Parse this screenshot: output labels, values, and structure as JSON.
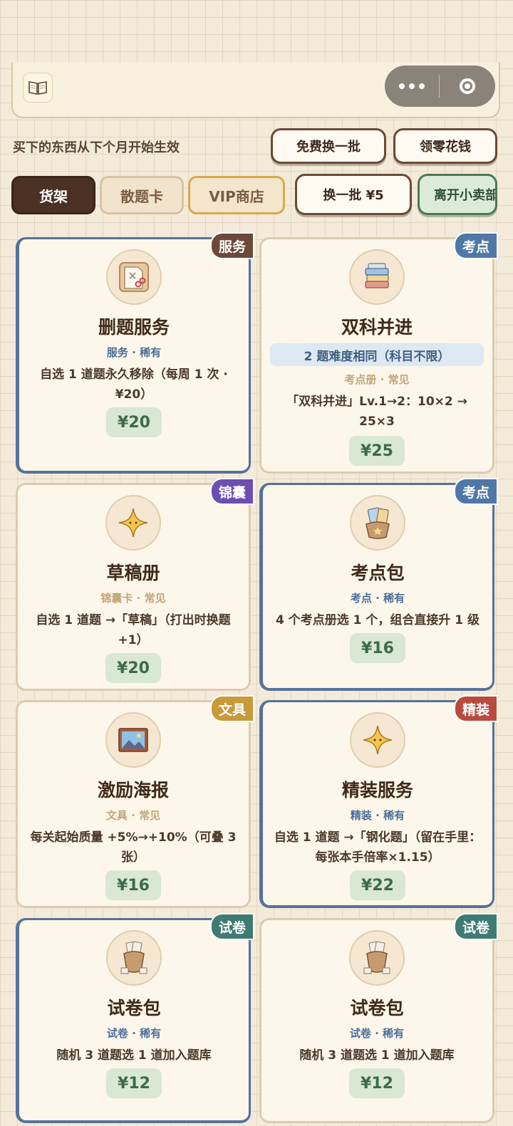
{
  "notice": "买下的东西从下个月开始生效",
  "buttons": {
    "free_refresh": "免费换一批",
    "collect_money": "领零花钱",
    "refresh_paid": "换一批 ¥5",
    "leave_shop": "离开小卖部"
  },
  "tabs": [
    "货架",
    "散题卡",
    "VIP商店"
  ],
  "cards": [
    {
      "badge": "服务",
      "badge_color": "#6b4a3a",
      "title": "删题服务",
      "type_label": "服务",
      "rarity": "稀有",
      "meta_color": "#4a6f99",
      "desc": "自选 1 道题永久移除（每周 1 次 · ¥20）",
      "price": "¥20",
      "icon": "scissors-paper-icon"
    },
    {
      "badge": "考点",
      "badge_color": "#4f78a6",
      "title": "双科并进",
      "highlight": "2 题难度相同（科目不限）",
      "type_label": "考点册",
      "rarity": "常见",
      "meta_color": "#c2a47a",
      "desc": "「双科并进」Lv.1→2：10×2 → 25×3",
      "price": "¥25",
      "icon": "book-stack-icon"
    },
    {
      "badge": "锦囊",
      "badge_color": "#6c4fb0",
      "title": "草稿册",
      "type_label": "锦囊卡",
      "rarity": "常见",
      "meta_color": "#c2a47a",
      "desc": "自选 1 道题 →「草稿」（打出时换题+1）",
      "price": "¥20",
      "icon": "star-icon"
    },
    {
      "badge": "考点",
      "badge_color": "#4f78a6",
      "title": "考点包",
      "type_label": "考点",
      "rarity": "稀有",
      "meta_color": "#4a6f99",
      "desc": "4 个考点册选 1 个，组合直接升 1 级",
      "price": "¥16",
      "icon": "card-pack-icon"
    },
    {
      "badge": "文具",
      "badge_color": "#c99a3a",
      "title": "激励海报",
      "type_label": "文具",
      "rarity": "常见",
      "meta_color": "#c2a47a",
      "desc": "每关起始质量 +5%→+10%（可叠 3 张）",
      "price": "¥16",
      "icon": "poster-icon"
    },
    {
      "badge": "精装",
      "badge_color": "#b84a3e",
      "title": "精装服务",
      "type_label": "精装",
      "rarity": "稀有",
      "meta_color": "#4a6f99",
      "desc": "自选 1 道题 →「钢化题」（留在手里：每张本手倍率×1.15）",
      "price": "¥22",
      "icon": "star-icon"
    },
    {
      "badge": "试卷",
      "badge_color": "#3e7c72",
      "title": "试卷包",
      "type_label": "试卷",
      "rarity": "稀有",
      "meta_color": "#4a6f99",
      "desc": "随机 3 道题选 1 道加入题库",
      "price": "¥12",
      "icon": "paper-bag-icon"
    },
    {
      "badge": "试卷",
      "badge_color": "#3e7c72",
      "title": "试卷包",
      "type_label": "试卷",
      "rarity": "稀有",
      "meta_color": "#4a6f99",
      "desc": "随机 3 道题选 1 道加入题库",
      "price": "¥12",
      "icon": "paper-bag-icon"
    }
  ]
}
